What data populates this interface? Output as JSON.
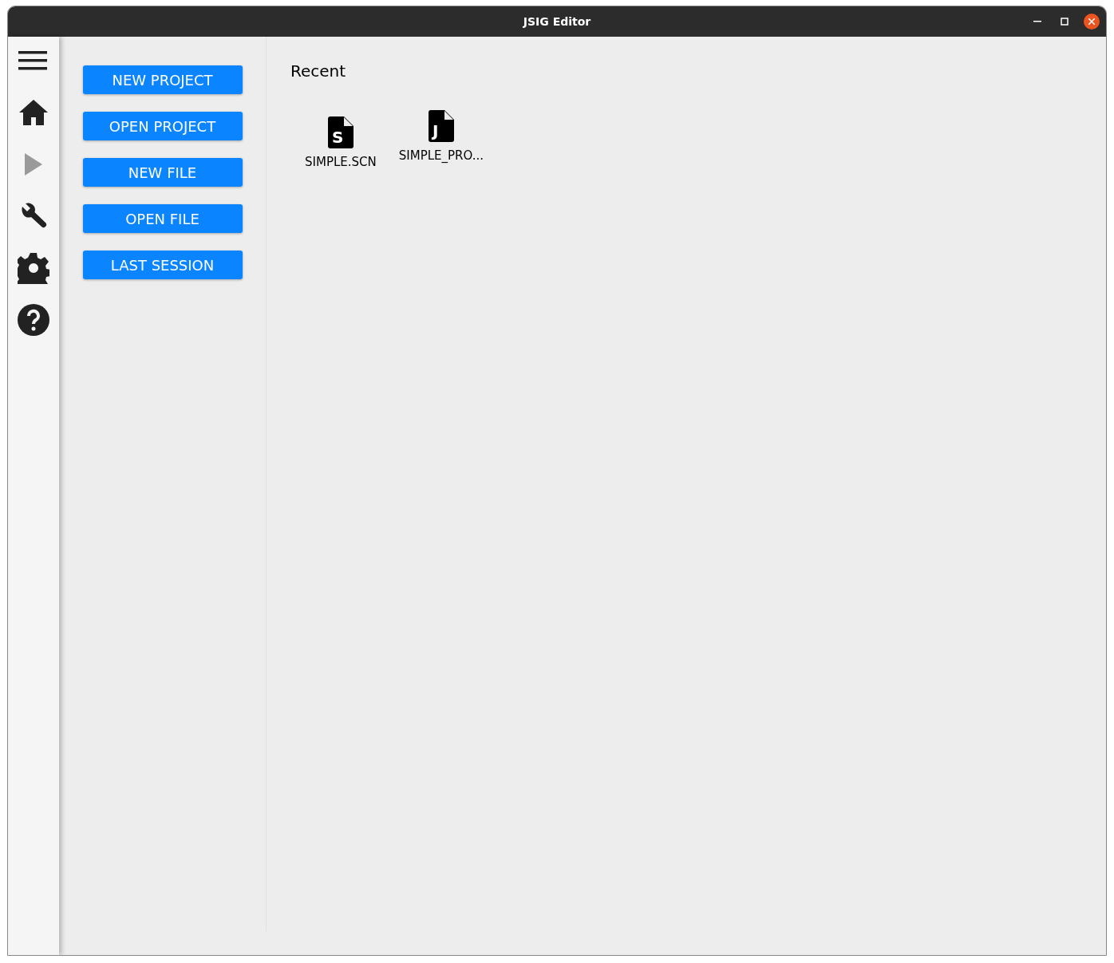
{
  "window": {
    "title": "JSIG Editor"
  },
  "sidebar": {
    "items": [
      {
        "kind": "menu",
        "disabled": false
      },
      {
        "kind": "home",
        "disabled": false
      },
      {
        "kind": "play",
        "disabled": true
      },
      {
        "kind": "wrench",
        "disabled": false
      },
      {
        "kind": "gear",
        "disabled": false
      },
      {
        "kind": "help",
        "disabled": false
      }
    ]
  },
  "actions": [
    "NEW PROJECT",
    "OPEN PROJECT",
    "NEW FILE",
    "OPEN FILE",
    "LAST SESSION"
  ],
  "recent": {
    "title": "Recent",
    "files": [
      {
        "letter": "S",
        "name": "SIMPLE.SCN"
      },
      {
        "letter": "J",
        "name": "SIMPLE_PRO..."
      }
    ]
  }
}
